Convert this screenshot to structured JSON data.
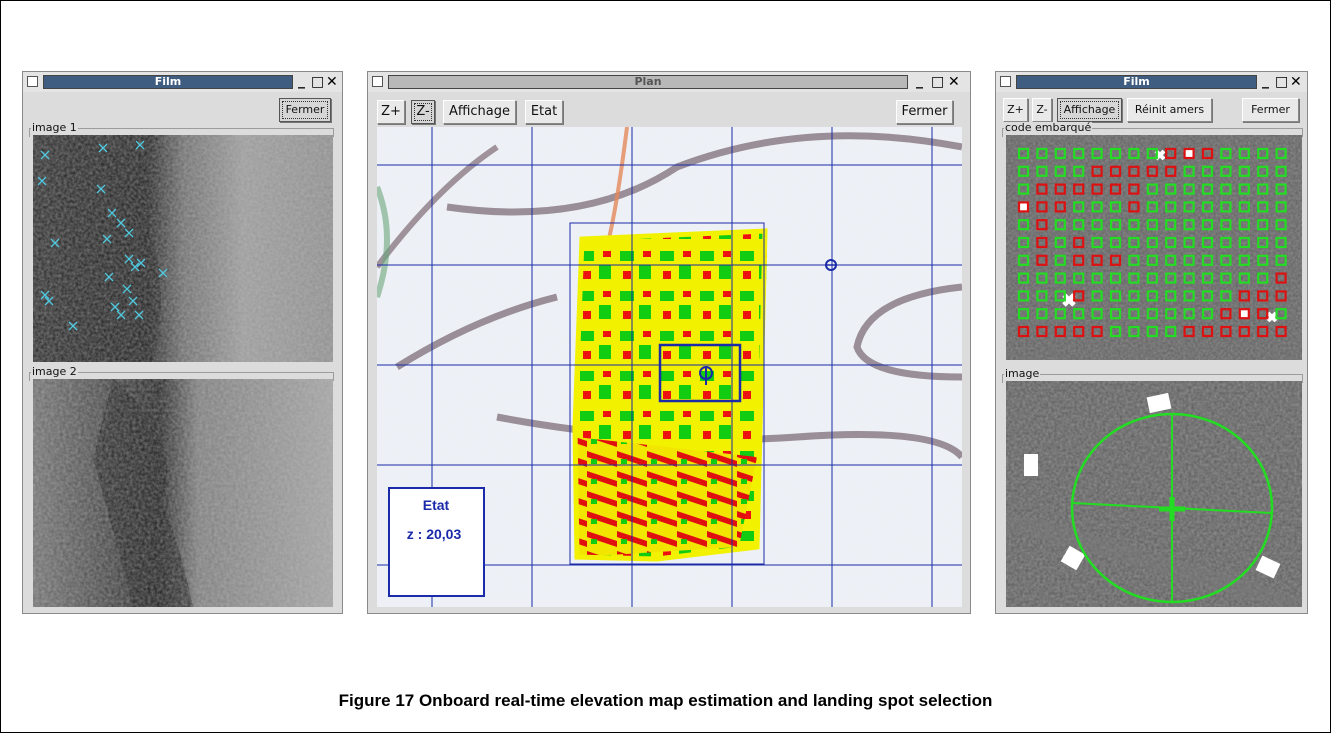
{
  "left_window": {
    "title": "Film",
    "close_button": "Fermer",
    "group1_label": "image 1",
    "group2_label": "image 2"
  },
  "center_window": {
    "title": "Plan",
    "buttons": {
      "zoom_in": "Z+",
      "zoom_out": "Z-",
      "display": "Affichage",
      "state": "Etat",
      "close": "Fermer"
    },
    "state_panel": {
      "title": "Etat",
      "value": "z : 20,03"
    }
  },
  "right_window": {
    "title": "Film",
    "buttons": {
      "zoom_in": "Z+",
      "zoom_out": "Z-",
      "display": "Affichage",
      "reset": "Réinit amers",
      "close": "Fermer"
    },
    "group1_label": "code embarqué",
    "group2_label": "image"
  },
  "figure_caption": "Figure 17 Onboard real-time elevation map estimation and landing spot selection",
  "colors": {
    "title_active": "#3f5d80",
    "grid_blue": "#1a2aa8",
    "marker_cyan": "#4fc8e0",
    "ok_green": "#22dd22",
    "bad_red": "#dd1111"
  },
  "window_controls": {
    "minimize": "_",
    "maximize": "□",
    "close": "✕"
  }
}
